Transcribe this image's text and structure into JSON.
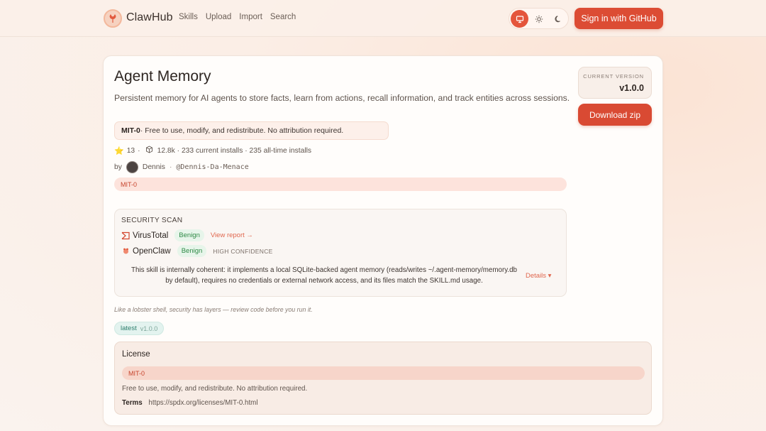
{
  "header": {
    "brand": "ClawHub",
    "nav": [
      "Skills",
      "Upload",
      "Import",
      "Search"
    ],
    "theme_options": [
      "monitor-icon",
      "sun-icon",
      "moon-icon"
    ],
    "active_theme": "monitor",
    "signin_label": "Sign in  with GitHub"
  },
  "skill": {
    "title": "Agent Memory",
    "description": "Persistent memory for AI agents to store facts, learn from actions, recall information, and track entities across sessions.",
    "license_short": "MIT-0",
    "license_note": " · Free to use, modify, and redistribute. No attribution required.",
    "stars": "13",
    "stats_text": "12.8k · 233 current installs · 235 all-time installs",
    "by_label": "by",
    "author": "Dennis",
    "author_sep": "·",
    "handle": "@Dennis-Da-Menace",
    "license_tag": "MIT-0"
  },
  "security_scan": {
    "heading": "SECURITY SCAN",
    "virustotal": {
      "name": "VirusTotal",
      "status": "Benign",
      "link": "View report →"
    },
    "openclaw": {
      "name": "OpenClaw",
      "status": "Benign",
      "confidence": "HIGH CONFIDENCE"
    },
    "summary": "This skill is internally coherent: it implements a local SQLite-backed agent memory (reads/writes ~/.agent-memory/memory.db by default), requires no credentials or external network access, and its files match the SKILL.md usage.",
    "details_label": "Details ▾"
  },
  "lobster_note": "Like a lobster shell, security has layers — review code before you run it.",
  "latest_tag": {
    "label": "latest",
    "version": "v1.0.0"
  },
  "license": {
    "heading": "License",
    "tag": "MIT-0",
    "text": "Free to use, modify, and redistribute. No attribution required.",
    "terms_label": "Terms",
    "terms_url": "https://spdx.org/licenses/MIT-0.html"
  },
  "version": {
    "label": "CURRENT VERSION",
    "value": "v1.0.0",
    "download_label": "Download zip"
  },
  "colors": {
    "accent": "#dc4c34",
    "benign_bg": "#e7f5ea",
    "benign_text": "#2f8a46"
  }
}
